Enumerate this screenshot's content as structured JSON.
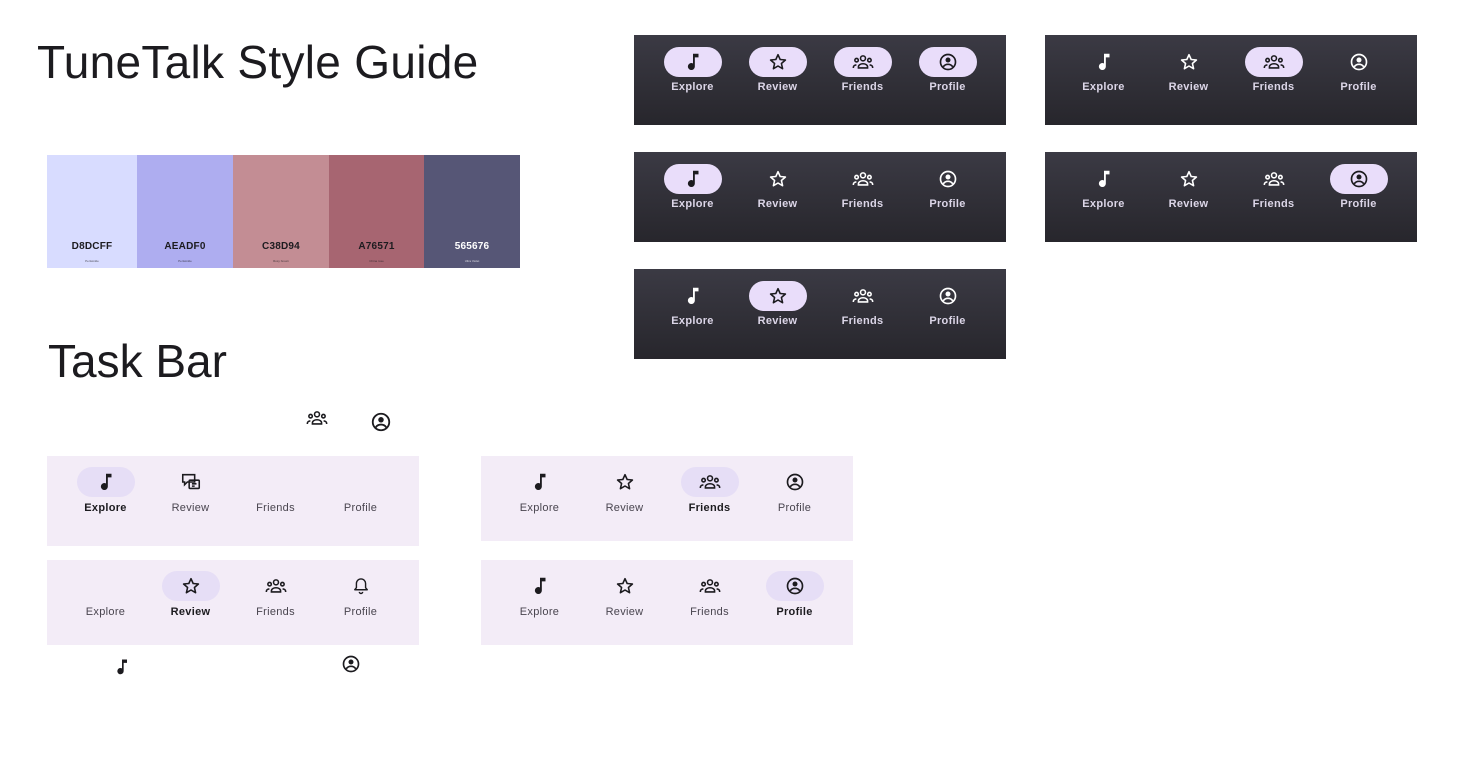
{
  "page": {
    "title": "TuneTalk Style Guide",
    "section_title": "Task Bar"
  },
  "palette": [
    {
      "hex": "D8DCFF",
      "name": "Periwinkle",
      "color": "#D8DCFF",
      "text_color": "#1c1b1f"
    },
    {
      "hex": "AEADF0",
      "name": "Periwinkle",
      "color": "#AEADF0",
      "text_color": "#1c1b1f"
    },
    {
      "hex": "C38D94",
      "name": "Rosy brown",
      "color": "#C38D94",
      "text_color": "#1c1b1f"
    },
    {
      "hex": "A76571",
      "name": "China rose",
      "color": "#A76571",
      "text_color": "#1c1b1f"
    },
    {
      "hex": "565676",
      "name": "Ultra Violet",
      "color": "#565676",
      "text_color": "#ffffff"
    }
  ],
  "nav_labels": {
    "explore": "Explore",
    "review": "Review",
    "friends": "Friends",
    "profile": "Profile"
  },
  "colors": {
    "dark_bar_bg": "#2f2e35",
    "dark_active_pill": "#E9DDFA",
    "light_bar_bg": "#F3ECF7",
    "light_active_pill": "#E6DEF6",
    "icon_dark": "#1c1b1f",
    "icon_light": "#ffffff"
  },
  "icons": [
    "music-note-icon",
    "star-icon",
    "group-icon",
    "account-circle-icon",
    "chat-card-icon",
    "bell-icon"
  ]
}
